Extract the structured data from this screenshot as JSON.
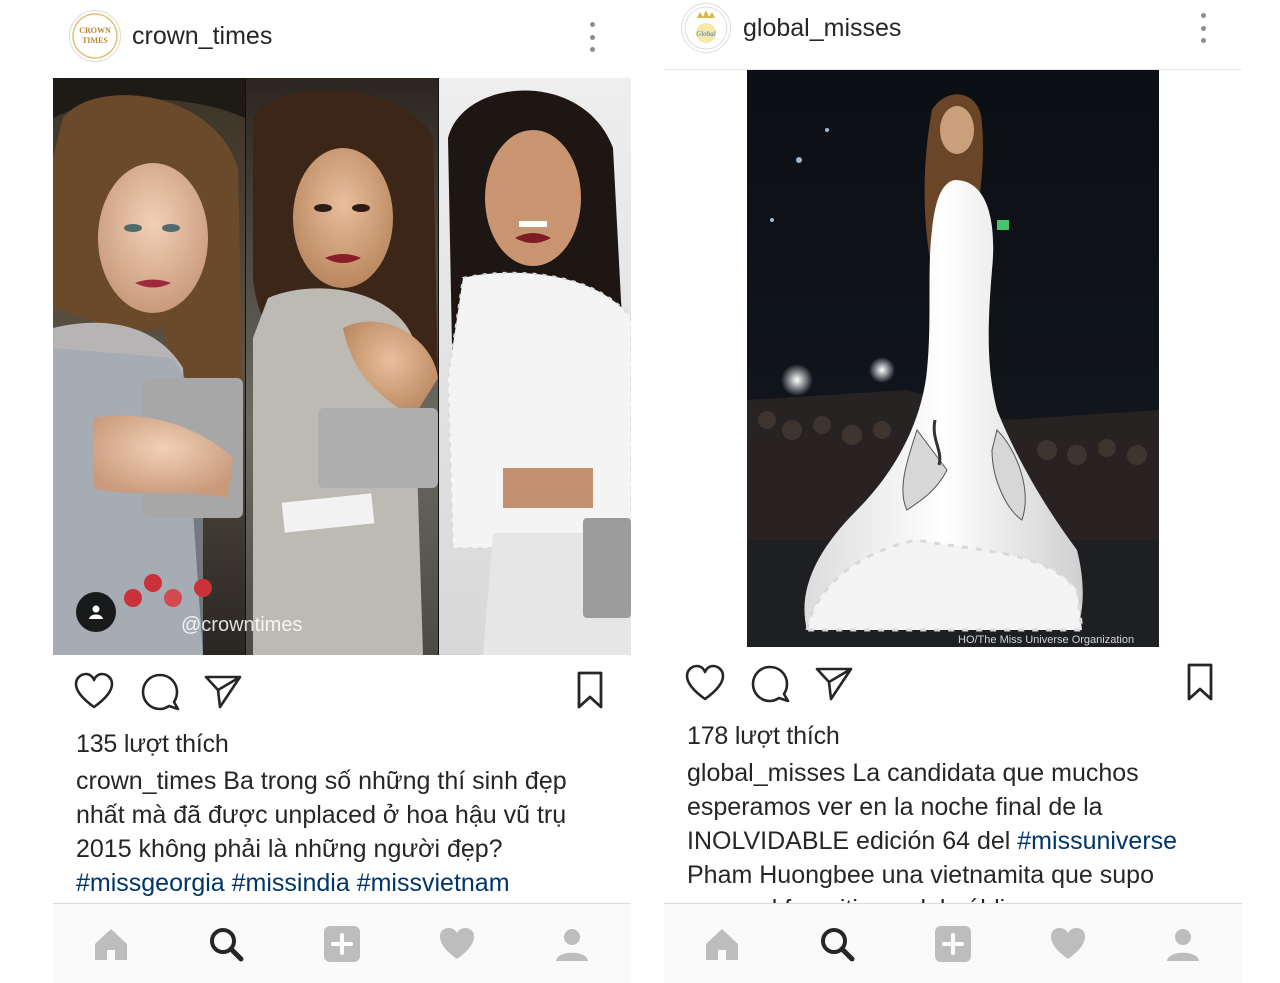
{
  "left_post": {
    "username": "crown_times",
    "avatar_text": "CROWN TIMES",
    "watermark": "@crowntimes",
    "likes": "135 lượt thích",
    "caption_user": "crown_times",
    "caption_lines": [
      " Ba trong số những thí sinh đẹp",
      "nhất mà đã được unplaced ở hoa hậu vũ trụ",
      "2015 không phải là những người đẹp?"
    ],
    "hashtags": [
      "#missgeorgia",
      "#missindia",
      "#missvietnam"
    ]
  },
  "right_post": {
    "username": "global_misses",
    "avatar_text": "Global Misses",
    "photo_credit": "HO/The Miss Universe Organization",
    "likes": "178 lượt thích",
    "caption_user": "global_misses",
    "caption_line1_rest": " La candidata que muchos",
    "caption_line2": "esperamos ver en la noche final de la",
    "caption_line3_text": "INOLVIDABLE edición 64 del ",
    "caption_line3_hashtag": "#missuniverse",
    "caption_line4": "Pham Huongbee una vietnamita que supo",
    "caption_line5_partial": "ganar el favoritismo del público"
  },
  "icons": {
    "like": "heart-outline-icon",
    "comment": "comment-bubble-icon",
    "share": "paper-plane-icon",
    "save": "bookmark-icon",
    "more": "vertical-dots-icon",
    "tabs": [
      "home-icon",
      "search-icon",
      "add-post-icon",
      "activity-heart-icon",
      "profile-icon"
    ]
  },
  "colors": {
    "text": "#262626",
    "hashtag": "#003569",
    "icon_gray": "#bdbdbd",
    "icon_active": "#262626",
    "tabbar_bg": "#fafafa"
  }
}
